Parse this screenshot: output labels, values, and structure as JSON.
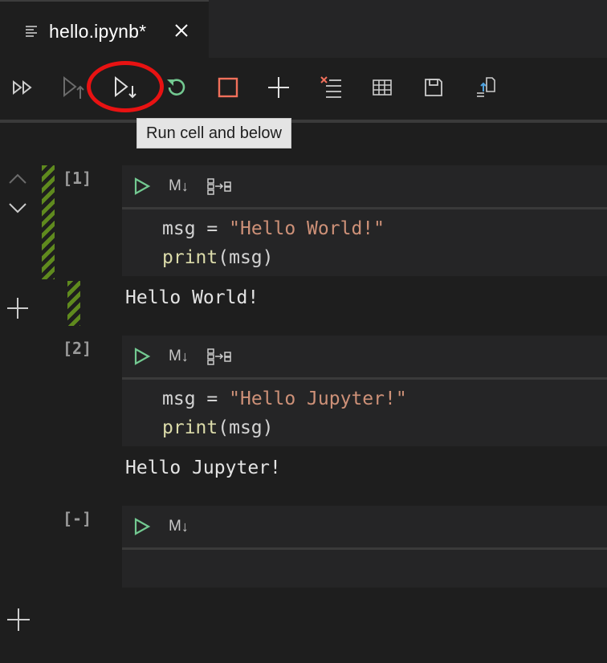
{
  "tab": {
    "title": "hello.ipynb*",
    "icon": "notebook-lines-icon",
    "close_icon": "close-icon"
  },
  "toolbar": {
    "buttons": [
      {
        "name": "run-all",
        "icon": "run-all-icon"
      },
      {
        "name": "run-above",
        "icon": "run-above-icon"
      },
      {
        "name": "run-cell-and-below",
        "icon": "run-below-icon"
      },
      {
        "name": "restart-kernel",
        "icon": "restart-icon"
      },
      {
        "name": "interrupt-kernel",
        "icon": "stop-icon"
      },
      {
        "name": "add-cell",
        "icon": "plus-icon"
      },
      {
        "name": "clear-outputs",
        "icon": "clear-outputs-icon"
      },
      {
        "name": "variable-explorer",
        "icon": "table-icon"
      },
      {
        "name": "save",
        "icon": "save-icon"
      },
      {
        "name": "export",
        "icon": "export-icon"
      }
    ],
    "tooltip": "Run cell and below",
    "highlighted": "run-cell-and-below"
  },
  "cells": [
    {
      "count": "[1]",
      "markdown_toggle": "M",
      "code": {
        "var": "msg",
        "op": "=",
        "string": "\"Hello World!\"",
        "fn": "print",
        "args": "(msg)"
      },
      "output": "Hello World!"
    },
    {
      "count": "[2]",
      "markdown_toggle": "M",
      "code": {
        "var": "msg",
        "op": "=",
        "string": "\"Hello Jupyter!\"",
        "fn": "print",
        "args": "(msg)"
      },
      "output": "Hello Jupyter!"
    },
    {
      "count": "[-]",
      "markdown_toggle": "M"
    }
  ],
  "colors": {
    "background": "#1e1e1e",
    "cell_background": "#252526",
    "run_green": "#73c991",
    "stop_red": "#f1705b",
    "stripe_green": "#5f8a1e",
    "highlight_red": "#e81212",
    "string": "#ce9178",
    "function": "#dcdcaa"
  }
}
